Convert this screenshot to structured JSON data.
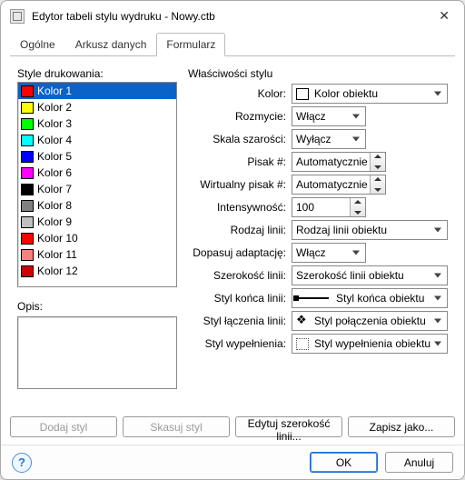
{
  "window": {
    "title": "Edytor tabeli stylu wydruku - Nowy.ctb"
  },
  "tabs": {
    "general": "Ogólne",
    "data_sheet": "Arkusz danych",
    "form": "Formularz"
  },
  "left": {
    "styles_label": "Style drukowania:",
    "items": [
      {
        "label": "Kolor 1",
        "color": "#ff0000",
        "selected": true
      },
      {
        "label": "Kolor 2",
        "color": "#ffff00"
      },
      {
        "label": "Kolor 3",
        "color": "#00ff00"
      },
      {
        "label": "Kolor 4",
        "color": "#00ffff"
      },
      {
        "label": "Kolor 5",
        "color": "#0000ff"
      },
      {
        "label": "Kolor 6",
        "color": "#ff00ff"
      },
      {
        "label": "Kolor 7",
        "color": "#000000"
      },
      {
        "label": "Kolor 8",
        "color": "#808080"
      },
      {
        "label": "Kolor 9",
        "color": "#c0c0c0"
      },
      {
        "label": "Kolor 10",
        "color": "#ff0000"
      },
      {
        "label": "Kolor 11",
        "color": "#ff7f7f"
      },
      {
        "label": "Kolor 12",
        "color": "#cc0000"
      }
    ],
    "opis_label": "Opis:",
    "opis_value": ""
  },
  "right": {
    "header": "Właściwości stylu",
    "rows": {
      "color": {
        "label": "Kolor:",
        "value": "Kolor obiektu"
      },
      "dither": {
        "label": "Rozmycie:",
        "value": "Włącz"
      },
      "gray": {
        "label": "Skala szarości:",
        "value": "Wyłącz"
      },
      "pen": {
        "label": "Pisak #:",
        "value": "Automatycznie"
      },
      "vpen": {
        "label": "Wirtualny pisak #:",
        "value": "Automatycznie"
      },
      "intensity": {
        "label": "Intensywność:",
        "value": "100"
      },
      "linetype": {
        "label": "Rodzaj linii:",
        "value": "Rodzaj linii obiektu"
      },
      "adaptive": {
        "label": "Dopasuj adaptację:",
        "value": "Włącz"
      },
      "lineweight": {
        "label": "Szerokość linii:",
        "value": "Szerokość linii obiektu"
      },
      "endstyle": {
        "label": "Styl końca linii:",
        "value": "Styl końca obiektu"
      },
      "joinstyle": {
        "label": "Styl łączenia linii:",
        "value": "Styl połączenia obiektu"
      },
      "fillstyle": {
        "label": "Styl wypełnienia:",
        "value": "Styl wypełnienia obiektu"
      }
    }
  },
  "buttons": {
    "add_style": "Dodaj styl",
    "delete_style": "Skasuj styl",
    "edit_lineweights": "Edytuj szerokość linii...",
    "save_as": "Zapisz jako..."
  },
  "footer": {
    "help": "?",
    "ok": "OK",
    "cancel": "Anuluj"
  }
}
